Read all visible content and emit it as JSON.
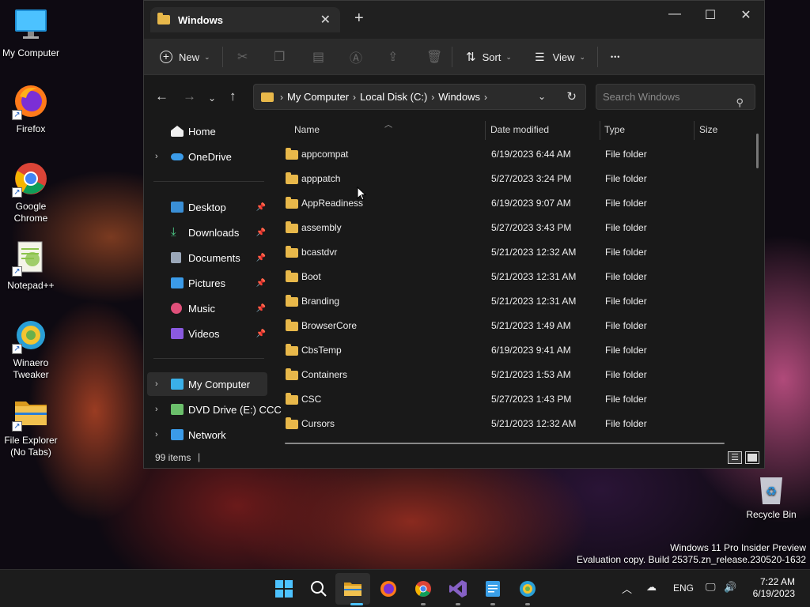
{
  "desktop": {
    "icons": [
      {
        "label": "My Computer"
      },
      {
        "label": "Firefox"
      },
      {
        "label": "Google Chrome"
      },
      {
        "label": "Notepad++"
      },
      {
        "label": "Winaero Tweaker"
      },
      {
        "label": "File Explorer (No Tabs)"
      }
    ],
    "recycle_bin": "Recycle Bin",
    "watermark_line1": "Windows 11 Pro Insider Preview",
    "watermark_line2": "Evaluation copy. Build 25375.zn_release.230520-1632"
  },
  "window": {
    "tab_title": "Windows",
    "new_tab_glyph": "+",
    "controls": {
      "minimize": "—",
      "maximize": "☐",
      "close": "✕"
    }
  },
  "toolbar": {
    "new_label": "New",
    "sort_label": "Sort",
    "view_label": "View",
    "more_glyph": "•••"
  },
  "address": {
    "crumbs": [
      "My Computer",
      "Local Disk (C:)",
      "Windows"
    ],
    "search_placeholder": "Search Windows"
  },
  "nav": {
    "home": "Home",
    "onedrive": "OneDrive",
    "desktop": "Desktop",
    "downloads": "Downloads",
    "documents": "Documents",
    "pictures": "Pictures",
    "music": "Music",
    "videos": "Videos",
    "my_computer": "My Computer",
    "dvd": "DVD Drive (E:) CCC",
    "network": "Network"
  },
  "columns": {
    "name": "Name",
    "date": "Date modified",
    "type": "Type",
    "size": "Size"
  },
  "files": [
    {
      "name": "appcompat",
      "date": "6/19/2023 6:44 AM",
      "type": "File folder"
    },
    {
      "name": "apppatch",
      "date": "5/27/2023 3:24 PM",
      "type": "File folder"
    },
    {
      "name": "AppReadiness",
      "date": "6/19/2023 9:07 AM",
      "type": "File folder"
    },
    {
      "name": "assembly",
      "date": "5/27/2023 3:43 PM",
      "type": "File folder"
    },
    {
      "name": "bcastdvr",
      "date": "5/21/2023 12:32 AM",
      "type": "File folder"
    },
    {
      "name": "Boot",
      "date": "5/21/2023 12:31 AM",
      "type": "File folder"
    },
    {
      "name": "Branding",
      "date": "5/21/2023 12:31 AM",
      "type": "File folder"
    },
    {
      "name": "BrowserCore",
      "date": "5/21/2023 1:49 AM",
      "type": "File folder"
    },
    {
      "name": "CbsTemp",
      "date": "6/19/2023 9:41 AM",
      "type": "File folder"
    },
    {
      "name": "Containers",
      "date": "5/21/2023 1:53 AM",
      "type": "File folder"
    },
    {
      "name": "CSC",
      "date": "5/27/2023 1:43 PM",
      "type": "File folder"
    },
    {
      "name": "Cursors",
      "date": "5/21/2023 12:32 AM",
      "type": "File folder"
    }
  ],
  "status": {
    "count": "99 items"
  },
  "taskbar": {
    "language": "ENG",
    "time": "7:22 AM",
    "date": "6/19/2023"
  },
  "colors": {
    "folder": "#e8b84a",
    "accent": "#4cc2ff"
  }
}
